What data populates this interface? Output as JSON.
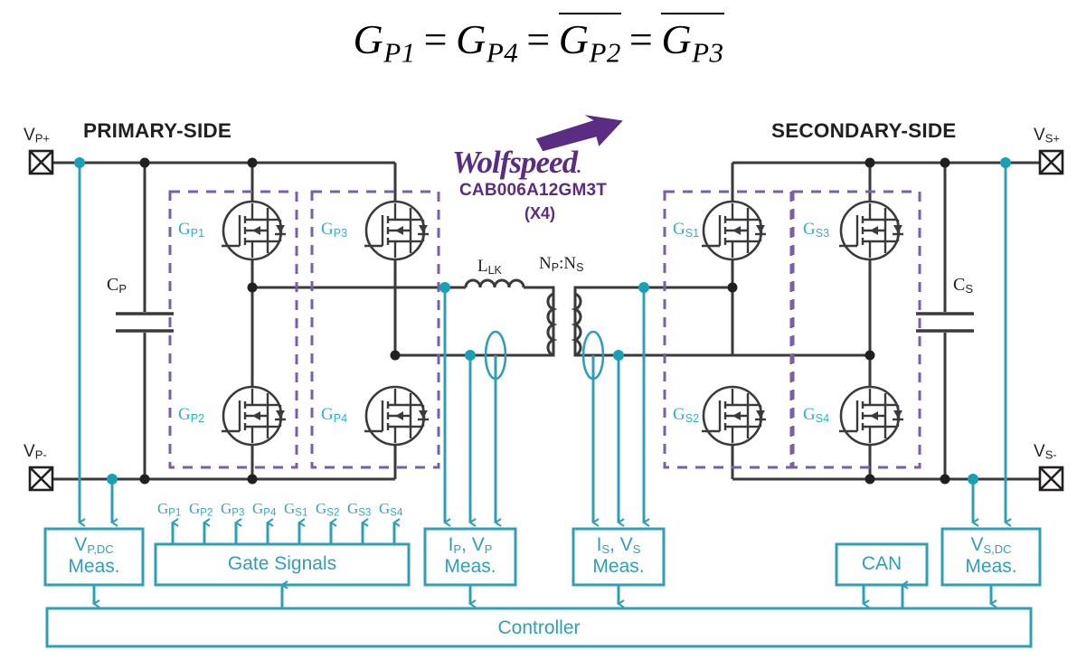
{
  "equation": {
    "terms": [
      "G_P1",
      "G_P4",
      "G_P2_bar",
      "G_P3_bar"
    ],
    "plain": "G_P1 = G_P4 = not(G_P2) = not(G_P3)",
    "g": "G",
    "eq": "=",
    "sub_p1": "P1",
    "sub_p4": "P4",
    "sub_p2": "P2",
    "sub_p3": "P3"
  },
  "diagram": {
    "title_primary": "PRIMARY-SIDE",
    "title_secondary": "SECONDARY-SIDE",
    "terminals": {
      "vp_plus": "V",
      "vp_plus_sub": "P+",
      "vp_minus": "V",
      "vp_minus_sub": "P-",
      "vs_plus": "V",
      "vs_plus_sub": "S+",
      "vs_minus": "V",
      "vs_minus_sub": "S-"
    },
    "capacitors": {
      "cp": "C",
      "cp_sub": "P",
      "cs": "C",
      "cs_sub": "S"
    },
    "transformer": {
      "leakage": "L",
      "leakage_sub": "LK",
      "turns": "N",
      "turns_sub_p": "P",
      "turns_colon": ":",
      "turns_n2": "N",
      "turns_sub_s": "S"
    },
    "gate_nodes": [
      {
        "id": "gp1",
        "g": "G",
        "sub": "P1"
      },
      {
        "id": "gp2",
        "g": "G",
        "sub": "P2"
      },
      {
        "id": "gp3",
        "g": "G",
        "sub": "P3"
      },
      {
        "id": "gp4",
        "g": "G",
        "sub": "P4"
      },
      {
        "id": "gs1",
        "g": "G",
        "sub": "S1"
      },
      {
        "id": "gs2",
        "g": "G",
        "sub": "S2"
      },
      {
        "id": "gs3",
        "g": "G",
        "sub": "S3"
      },
      {
        "id": "gs4",
        "g": "G",
        "sub": "S4"
      }
    ],
    "vendor": {
      "wordmark": "Wolfspeed",
      "registered": ".",
      "part_number": "CAB006A12GM3T",
      "quantity": "(X4)",
      "brand_color": "#5b2d82"
    },
    "blocks": {
      "vp_dc_meas": {
        "line1": "V",
        "line1_sub": "P,DC",
        "line2": "Meas."
      },
      "gate_signals": {
        "label": "Gate Signals"
      },
      "ip_vp_meas": {
        "line1a": "I",
        "line1a_sub": "P",
        "sep": ", ",
        "line1b": "V",
        "line1b_sub": "P",
        "line2": "Meas."
      },
      "is_vs_meas": {
        "line1a": "I",
        "line1a_sub": "S",
        "sep": ", ",
        "line1b": "V",
        "line1b_sub": "S",
        "line2": "Meas."
      },
      "can": {
        "label": "CAN"
      },
      "vs_dc_meas": {
        "line1": "V",
        "line1_sub": "S,DC",
        "line2": "Meas."
      },
      "controller": {
        "label": "Controller"
      }
    },
    "gate_signal_labels": [
      "G_P1",
      "G_P2",
      "G_P3",
      "G_P4",
      "G_S1",
      "G_S2",
      "G_S3",
      "G_S4"
    ],
    "colors": {
      "wire": "#3a3a3c",
      "signal": "#2f9fb5",
      "module_outline": "#7b5ea7",
      "gate_label": "#2fb3c4",
      "background": "#ffffff"
    }
  }
}
